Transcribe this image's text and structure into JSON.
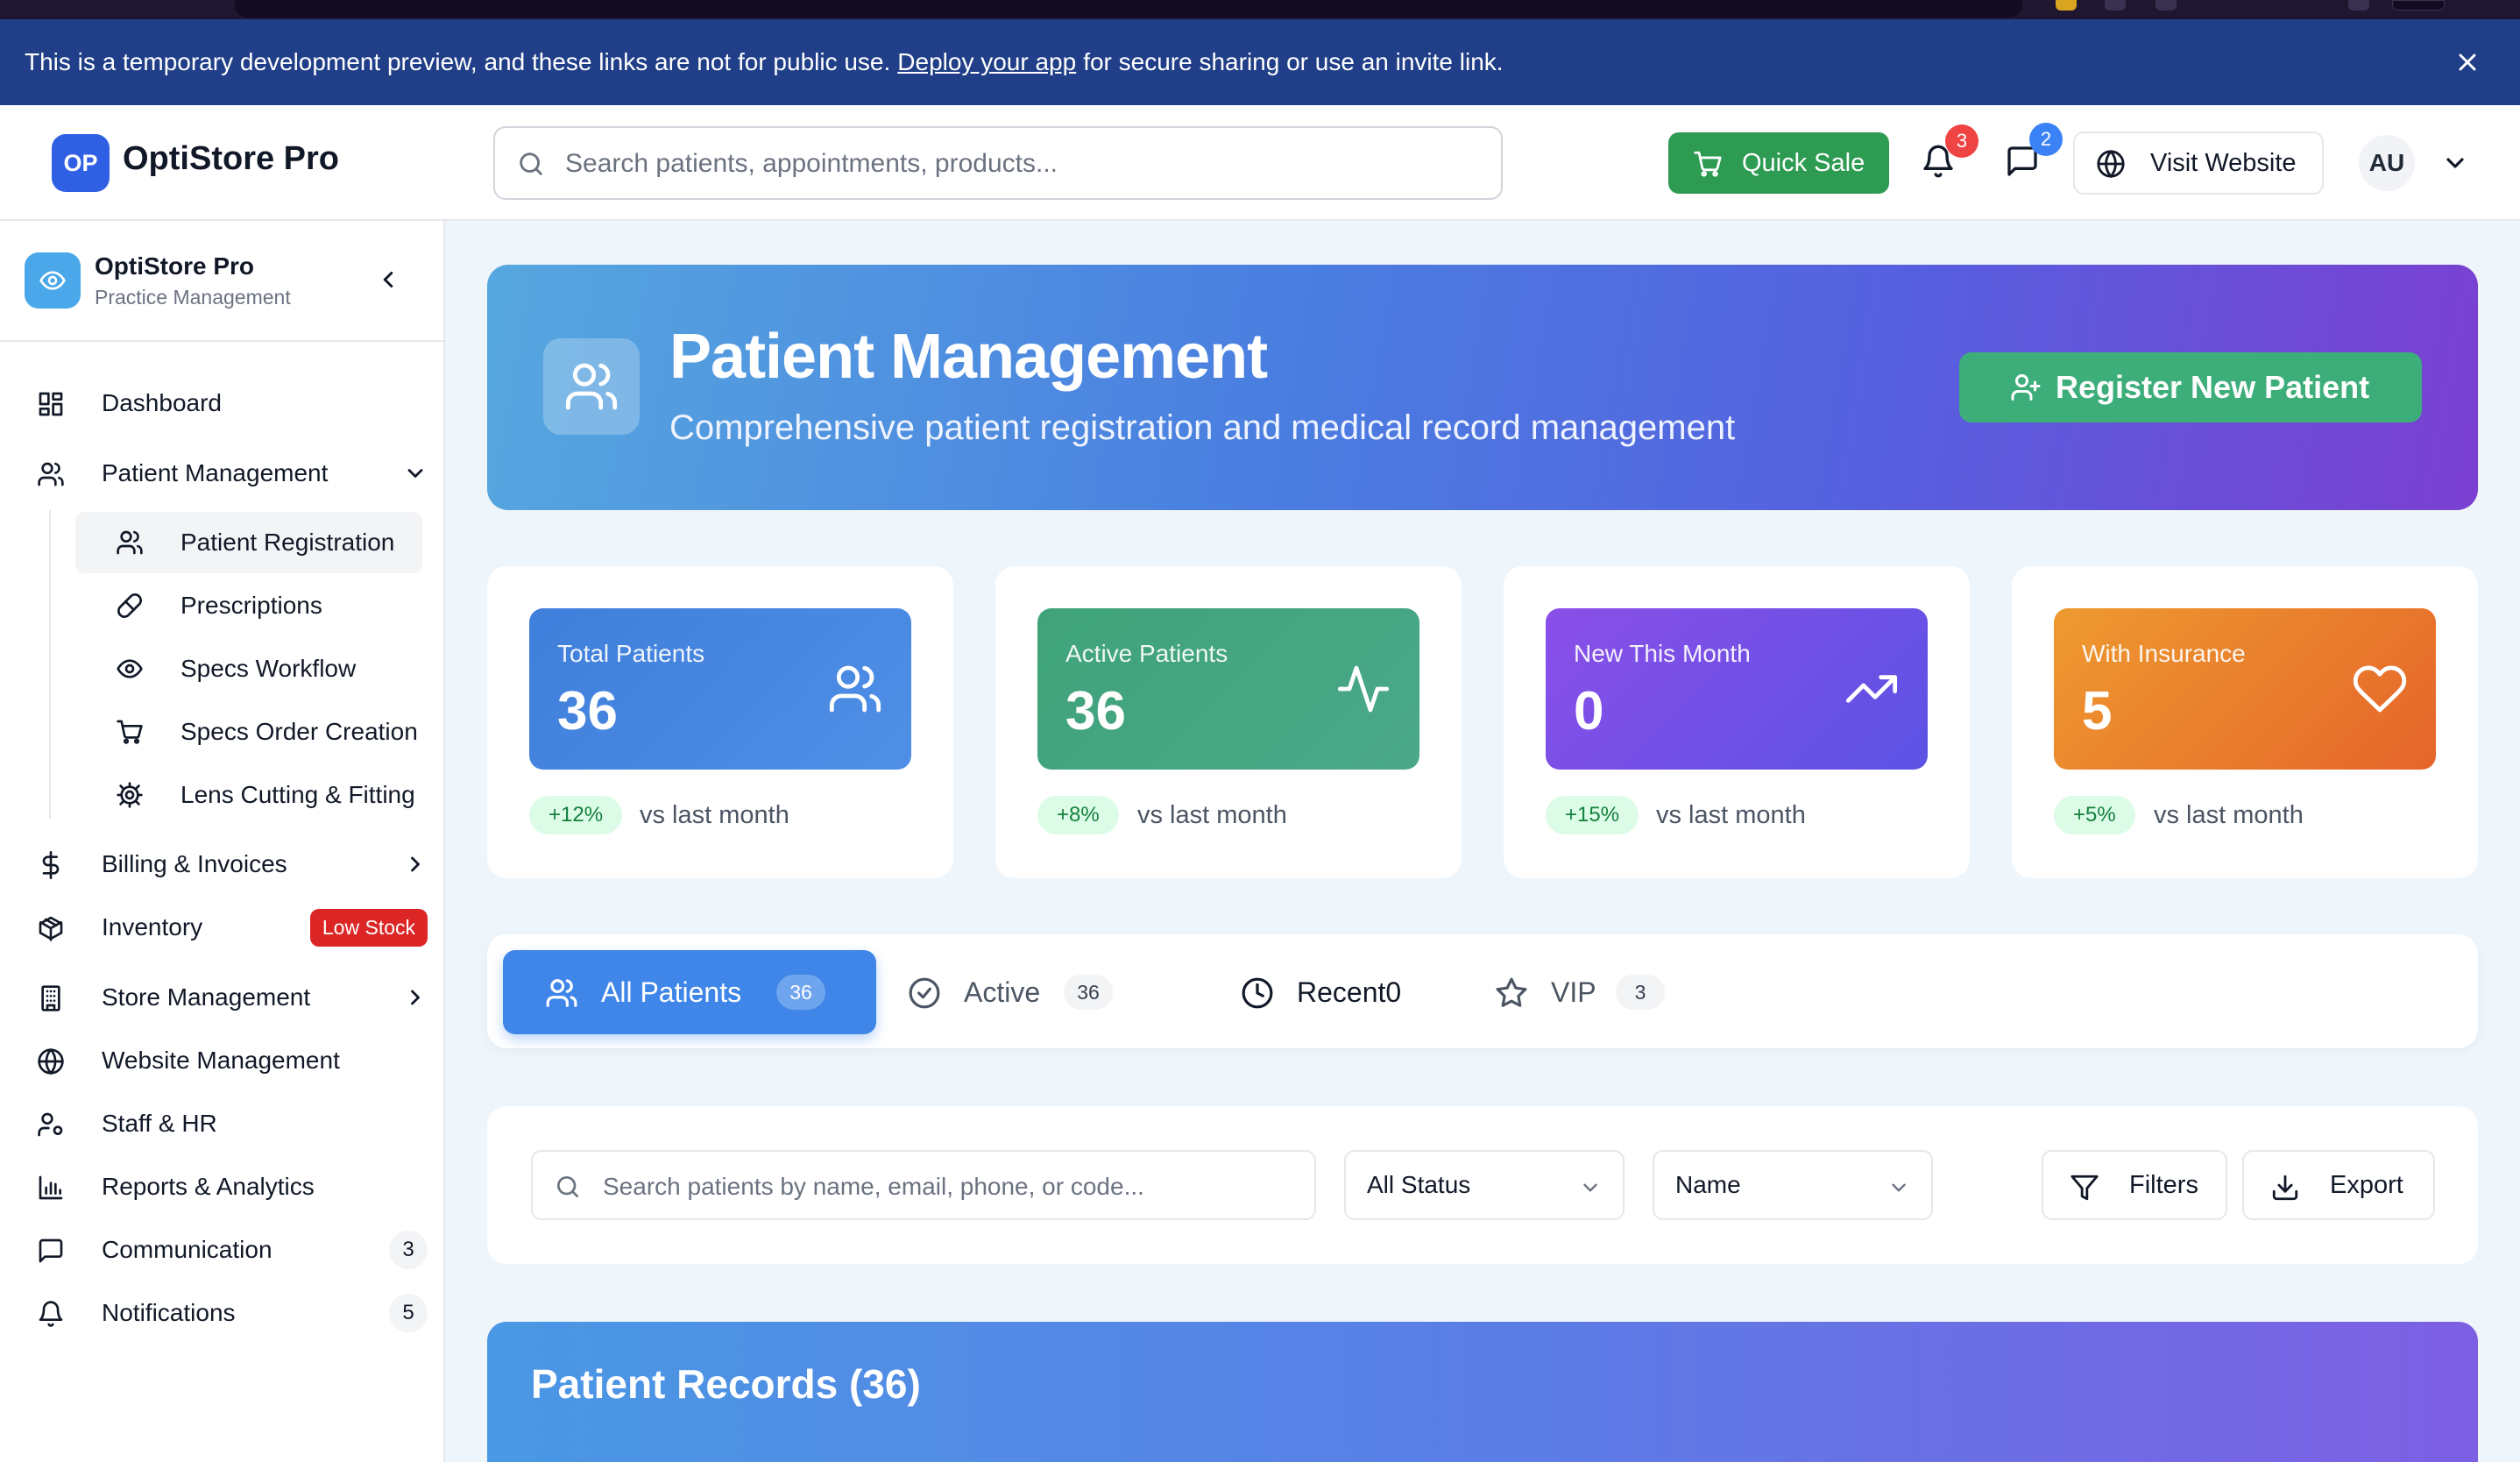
{
  "banner": {
    "text_before": "This is a temporary development preview, and these links are not for public use.",
    "link_text": "Deploy your app",
    "text_after": "for secure sharing or use an invite link."
  },
  "header": {
    "logo_initials": "OP",
    "app_name": "OptiStore Pro",
    "search_placeholder": "Search patients, appointments, products...",
    "quick_sale_label": "Quick Sale",
    "notifications_count": "3",
    "messages_count": "2",
    "visit_website_label": "Visit Website",
    "avatar_initials": "AU"
  },
  "sidebar": {
    "brand_title": "OptiStore Pro",
    "brand_subtitle": "Practice Management",
    "items": [
      {
        "label": "Dashboard",
        "icon": "dashboard-icon"
      },
      {
        "label": "Patient Management",
        "icon": "users-icon"
      },
      {
        "label": "Billing & Invoices",
        "icon": "dollar-icon"
      },
      {
        "label": "Inventory",
        "icon": "package-icon",
        "badge": "Low Stock"
      },
      {
        "label": "Store Management",
        "icon": "building-icon"
      },
      {
        "label": "Website Management",
        "icon": "globe-icon"
      },
      {
        "label": "Staff & HR",
        "icon": "user-cog-icon"
      },
      {
        "label": "Reports & Analytics",
        "icon": "bar-chart-icon"
      },
      {
        "label": "Communication",
        "icon": "message-icon",
        "count": "3"
      },
      {
        "label": "Notifications",
        "icon": "bell-icon",
        "count": "5"
      }
    ],
    "sub_items": [
      {
        "label": "Patient Registration",
        "icon": "users-icon"
      },
      {
        "label": "Prescriptions",
        "icon": "pill-icon"
      },
      {
        "label": "Specs Workflow",
        "icon": "eye-icon"
      },
      {
        "label": "Specs Order Creation",
        "icon": "cart-icon"
      },
      {
        "label": "Lens Cutting & Fitting",
        "icon": "gear-icon"
      }
    ]
  },
  "hero": {
    "title": "Patient Management",
    "subtitle": "Comprehensive patient registration and medical record management",
    "register_label": "Register New Patient"
  },
  "stats": [
    {
      "label": "Total Patients",
      "value": "36",
      "trend": "+12%",
      "vs": "vs last month",
      "icon": "users-icon",
      "color": "#3f7fdb"
    },
    {
      "label": "Active Patients",
      "value": "36",
      "trend": "+8%",
      "vs": "vs last month",
      "icon": "activity-icon",
      "color": "#3fa37a"
    },
    {
      "label": "New This Month",
      "value": "0",
      "trend": "+15%",
      "vs": "vs last month",
      "icon": "trending-up-icon",
      "color": "#7b4be6"
    },
    {
      "label": "With Insurance",
      "value": "5",
      "trend": "+5%",
      "vs": "vs last month",
      "icon": "heart-icon",
      "color": "#ec8a2e"
    }
  ],
  "tabs": [
    {
      "label": "All Patients",
      "count": "36"
    },
    {
      "label": "Active",
      "count": "36"
    },
    {
      "label": "Recent0",
      "count": ""
    },
    {
      "label": "VIP",
      "count": "3"
    }
  ],
  "filters": {
    "search_placeholder": "Search patients by name, email, phone, or code...",
    "status_value": "All Status",
    "sort_value": "Name",
    "filters_label": "Filters",
    "export_label": "Export"
  },
  "records": {
    "title": "Patient Records (36)"
  }
}
